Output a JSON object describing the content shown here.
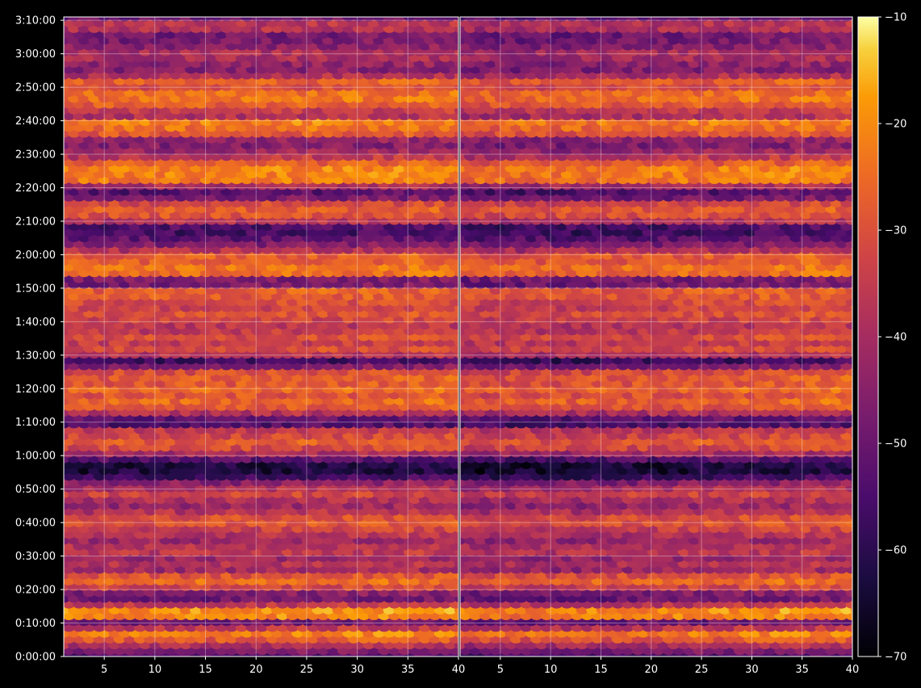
{
  "chart_data": {
    "type": "heatmap",
    "title": "",
    "xlabel": "",
    "ylabel": "",
    "grid": true,
    "panels": [
      {
        "name": "",
        "xlim": [
          1,
          40
        ]
      },
      {
        "name": "",
        "xlim": [
          1,
          40
        ]
      }
    ],
    "x_ticks": [
      5,
      10,
      15,
      20,
      25,
      30,
      35,
      40
    ],
    "y_ticks": [
      "0:00:00",
      "0:10:00",
      "0:20:00",
      "0:30:00",
      "0:40:00",
      "0:50:00",
      "1:00:00",
      "1:10:00",
      "1:20:00",
      "1:30:00",
      "1:40:00",
      "1:50:00",
      "2:00:00",
      "2:10:00",
      "2:20:00",
      "2:30:00",
      "2:40:00",
      "2:50:00",
      "3:00:00",
      "3:10:00"
    ],
    "ylim_seconds": [
      0,
      11460
    ],
    "colorbar": {
      "colormap": "inferno",
      "range": [
        -70,
        -10
      ],
      "ticks": [
        "−10",
        "−20",
        "−30",
        "−40",
        "−50",
        "−60",
        "−70"
      ]
    },
    "band_profile": {
      "description_minutes_to_level": [
        [
          0,
          -55
        ],
        [
          3,
          -42
        ],
        [
          5,
          -30
        ],
        [
          7,
          -22
        ],
        [
          8,
          -26
        ],
        [
          10,
          -58
        ],
        [
          12,
          -22
        ],
        [
          14,
          -20
        ],
        [
          16,
          -40
        ],
        [
          18,
          -55
        ],
        [
          20,
          -40
        ],
        [
          22,
          -24
        ],
        [
          24,
          -28
        ],
        [
          26,
          -42
        ],
        [
          28,
          -38
        ],
        [
          30,
          -45
        ],
        [
          32,
          -32
        ],
        [
          34,
          -44
        ],
        [
          36,
          -40
        ],
        [
          38,
          -35
        ],
        [
          40,
          -30
        ],
        [
          41,
          -24
        ],
        [
          42,
          -34
        ],
        [
          44,
          -40
        ],
        [
          46,
          -45
        ],
        [
          48,
          -32
        ],
        [
          50,
          -38
        ],
        [
          52,
          -45
        ],
        [
          54,
          -58
        ],
        [
          56,
          -65
        ],
        [
          58,
          -62
        ],
        [
          60,
          -45
        ],
        [
          62,
          -34
        ],
        [
          64,
          -28
        ],
        [
          66,
          -33
        ],
        [
          68,
          -36
        ],
        [
          70,
          -62
        ],
        [
          72,
          -45
        ],
        [
          74,
          -32
        ],
        [
          76,
          -25
        ],
        [
          78,
          -30
        ],
        [
          80,
          -26
        ],
        [
          82,
          -30
        ],
        [
          84,
          -28
        ],
        [
          86,
          -35
        ],
        [
          88,
          -64
        ],
        [
          90,
          -40
        ],
        [
          92,
          -32
        ],
        [
          94,
          -36
        ],
        [
          96,
          -30
        ],
        [
          98,
          -40
        ],
        [
          100,
          -36
        ],
        [
          102,
          -30
        ],
        [
          104,
          -34
        ],
        [
          106,
          -32
        ],
        [
          108,
          -28
        ],
        [
          110,
          -28
        ],
        [
          112,
          -64
        ],
        [
          114,
          -26
        ],
        [
          116,
          -24
        ],
        [
          118,
          -28
        ],
        [
          120,
          -28
        ],
        [
          122,
          -42
        ],
        [
          124,
          -50
        ],
        [
          126,
          -55
        ],
        [
          128,
          -60
        ],
        [
          130,
          -40
        ],
        [
          132,
          -30
        ],
        [
          134,
          -28
        ],
        [
          136,
          -35
        ],
        [
          138,
          -58
        ],
        [
          140,
          -48
        ],
        [
          142,
          -24
        ],
        [
          144,
          -22
        ],
        [
          146,
          -22
        ],
        [
          148,
          -30
        ],
        [
          150,
          -40
        ],
        [
          152,
          -45
        ],
        [
          154,
          -50
        ],
        [
          156,
          -30
        ],
        [
          158,
          -25
        ],
        [
          160,
          -22
        ],
        [
          162,
          -45
        ],
        [
          164,
          -30
        ],
        [
          166,
          -25
        ],
        [
          168,
          -24
        ],
        [
          170,
          -32
        ],
        [
          172,
          -28
        ],
        [
          174,
          -42
        ],
        [
          176,
          -48
        ],
        [
          178,
          -42
        ],
        [
          180,
          -38
        ],
        [
          182,
          -45
        ],
        [
          184,
          -48
        ],
        [
          186,
          -50
        ],
        [
          188,
          -35
        ],
        [
          190,
          -40
        ],
        [
          191,
          -50
        ]
      ]
    }
  }
}
